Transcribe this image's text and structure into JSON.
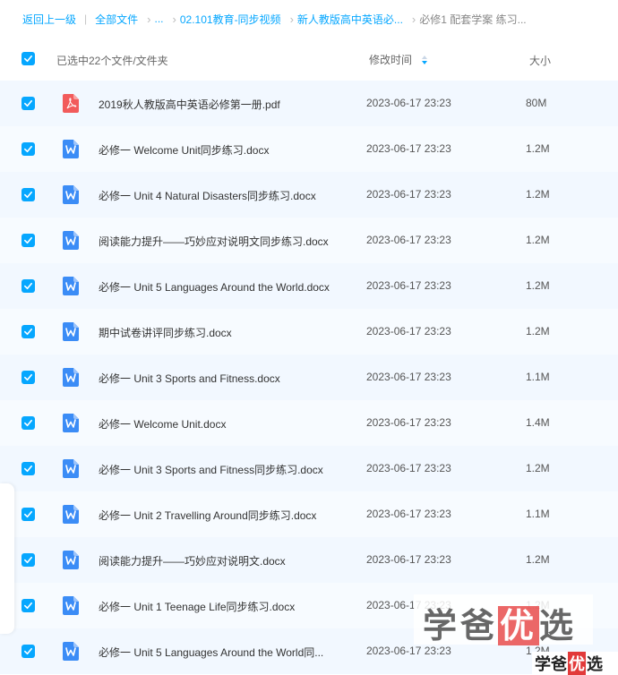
{
  "breadcrumb": {
    "back": "返回上一级",
    "all_files": "全部文件",
    "ellipsis": "...",
    "items": [
      "02.101教育-同步视频",
      "新人教版高中英语必..."
    ],
    "current": "必修1 配套学案 练习..."
  },
  "header": {
    "selected_text": "已选中22个文件/文件夹",
    "modified_time": "修改时间",
    "size": "大小"
  },
  "files": [
    {
      "name": "2019秋人教版高中英语必修第一册.pdf",
      "type": "pdf",
      "time": "2023-06-17 23:23",
      "size": "80M",
      "checked": true
    },
    {
      "name": "必修一 Welcome Unit同步练习.docx",
      "type": "docx",
      "time": "2023-06-17 23:23",
      "size": "1.2M",
      "checked": true
    },
    {
      "name": "必修一 Unit 4 Natural Disasters同步练习.docx",
      "type": "docx",
      "time": "2023-06-17 23:23",
      "size": "1.2M",
      "checked": true
    },
    {
      "name": "阅读能力提升——巧妙应对说明文同步练习.docx",
      "type": "docx",
      "time": "2023-06-17 23:23",
      "size": "1.2M",
      "checked": true
    },
    {
      "name": "必修一 Unit 5 Languages Around the World.docx",
      "type": "docx",
      "time": "2023-06-17 23:23",
      "size": "1.2M",
      "checked": true
    },
    {
      "name": "期中试卷讲评同步练习.docx",
      "type": "docx",
      "time": "2023-06-17 23:23",
      "size": "1.2M",
      "checked": true
    },
    {
      "name": "必修一 Unit 3 Sports and Fitness.docx",
      "type": "docx",
      "time": "2023-06-17 23:23",
      "size": "1.1M",
      "checked": true
    },
    {
      "name": "必修一 Welcome Unit.docx",
      "type": "docx",
      "time": "2023-06-17 23:23",
      "size": "1.4M",
      "checked": true
    },
    {
      "name": "必修一 Unit 3 Sports and Fitness同步练习.docx",
      "type": "docx",
      "time": "2023-06-17 23:23",
      "size": "1.2M",
      "checked": true
    },
    {
      "name": "必修一 Unit 2 Travelling Around同步练习.docx",
      "type": "docx",
      "time": "2023-06-17 23:23",
      "size": "1.1M",
      "checked": true
    },
    {
      "name": "阅读能力提升——巧妙应对说明文.docx",
      "type": "docx",
      "time": "2023-06-17 23:23",
      "size": "1.2M",
      "checked": true
    },
    {
      "name": "必修一 Unit 1 Teenage Life同步练习.docx",
      "type": "docx",
      "time": "2023-06-17 23:23",
      "size": "1.2M",
      "checked": true
    },
    {
      "name": "必修一 Unit 5 Languages Around the World同...",
      "type": "docx",
      "time": "2023-06-17 23:23",
      "size": "1.2M",
      "checked": true
    }
  ],
  "watermark": {
    "text_a": "学爸",
    "text_b": "优",
    "text_c": "选"
  },
  "colors": {
    "accent": "#06a7ff",
    "pdf": "#f25b5b",
    "docx": "#3b8cf6"
  }
}
